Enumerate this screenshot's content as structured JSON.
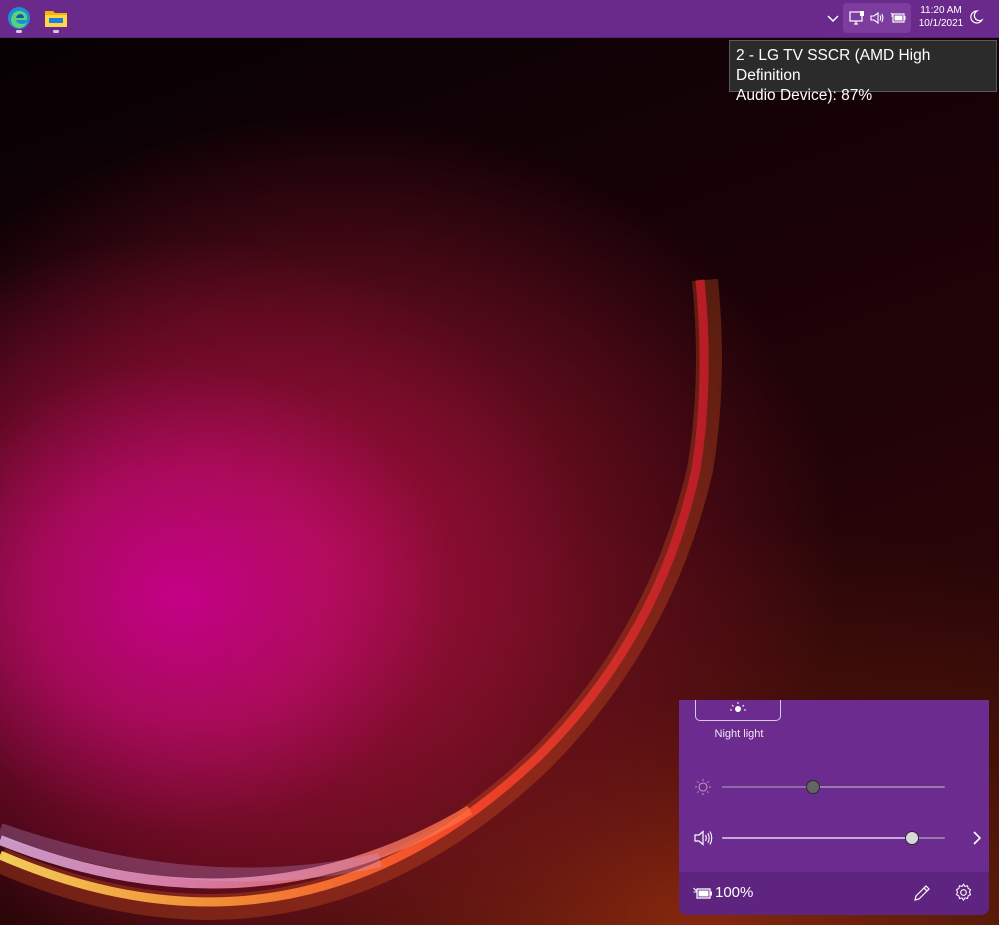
{
  "taskbar": {
    "apps": [
      {
        "name": "Microsoft Edge",
        "icon": "edge-icon"
      },
      {
        "name": "File Explorer",
        "icon": "folder-icon"
      }
    ],
    "tray": {
      "overflow_icon": "chevron-up-icon",
      "icons": [
        "network-icon",
        "volume-icon",
        "battery-icon"
      ],
      "time": "11:20 AM",
      "date": "10/1/2021",
      "focus_icon": "moon-icon"
    }
  },
  "tooltip": {
    "line1": "2 - LG TV SSCR (AMD High Definition",
    "line2": "Audio Device): 87%"
  },
  "quick_settings": {
    "night_light": {
      "label": "Night light",
      "icon": "night-light-icon"
    },
    "brightness": {
      "icon": "sun-icon",
      "value": 0.41
    },
    "volume": {
      "icon": "volume-icon",
      "value": 0.85,
      "arrow_icon": "chevron-right-icon"
    },
    "footer": {
      "battery_icon": "battery-charging-icon",
      "battery_label": "100%",
      "edit_icon": "pencil-icon",
      "settings_icon": "gear-icon"
    }
  },
  "colors": {
    "taskbar": "#6a2a8c",
    "panel": "#6c2b8e",
    "panel_footer": "#5f2480",
    "tooltip_bg": "#2b2b2b"
  }
}
